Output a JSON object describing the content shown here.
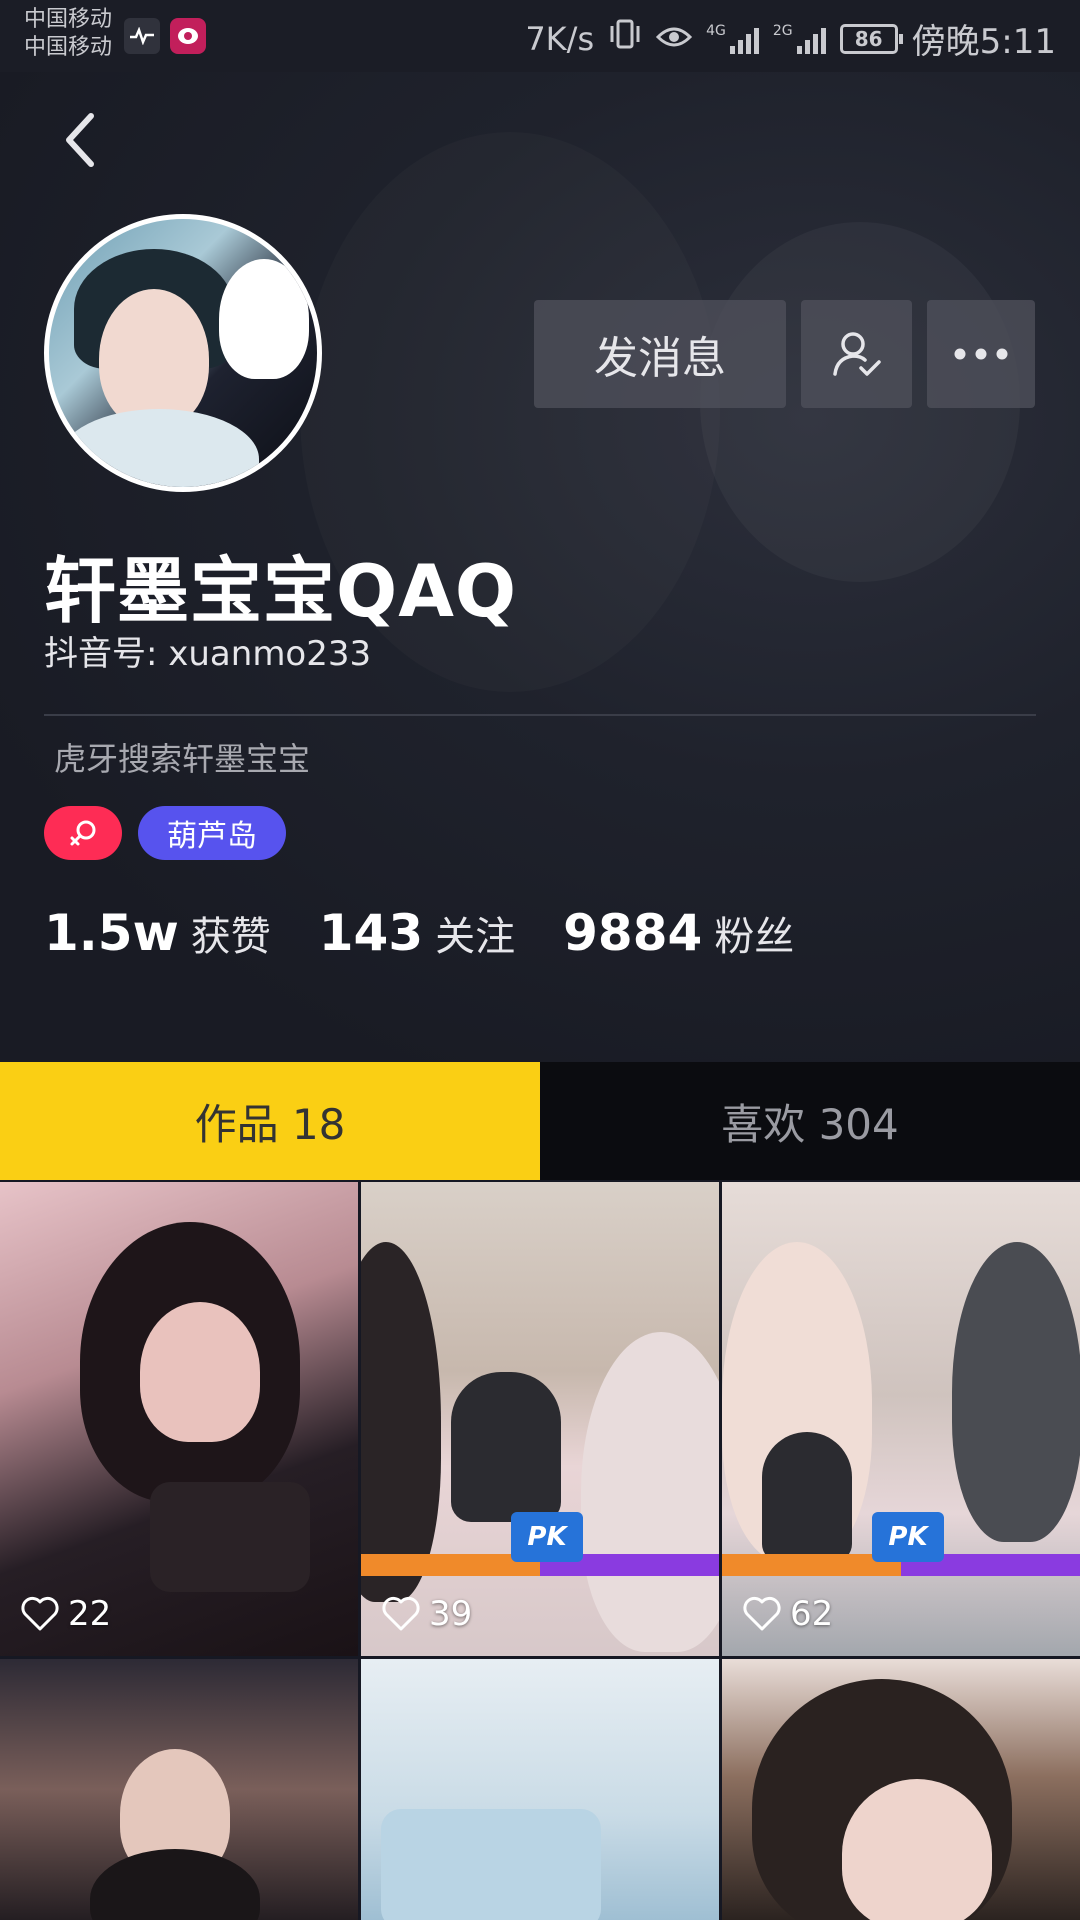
{
  "status_bar": {
    "carrier1": "中国移动",
    "carrier2": "中国移动",
    "net_speed": "7K/s",
    "sig1_label": "4G",
    "sig2_label": "2G",
    "battery": "86",
    "time": "傍晚5:11"
  },
  "profile": {
    "nickname": "轩墨宝宝QAQ",
    "douyin_id": "抖音号: xuanmo233",
    "bio": "虎牙搜索轩墨宝宝",
    "tag_island": "葫芦岛",
    "send_message_label": "发消息"
  },
  "stats": {
    "likes_num": "1.5w",
    "likes_label": "获赞",
    "following_num": "143",
    "following_label": "关注",
    "followers_num": "9884",
    "followers_label": "粉丝"
  },
  "tabs": {
    "works": "作品 18",
    "likes": "喜欢 304"
  },
  "videos": [
    {
      "likes": "22"
    },
    {
      "likes": "39"
    },
    {
      "likes": "62"
    }
  ],
  "pk_text": "PK",
  "colors": {
    "accent_yellow": "#facf14",
    "accent_red": "#fe2c55",
    "accent_purple": "#5753ee",
    "bg_dark": "#161823"
  }
}
